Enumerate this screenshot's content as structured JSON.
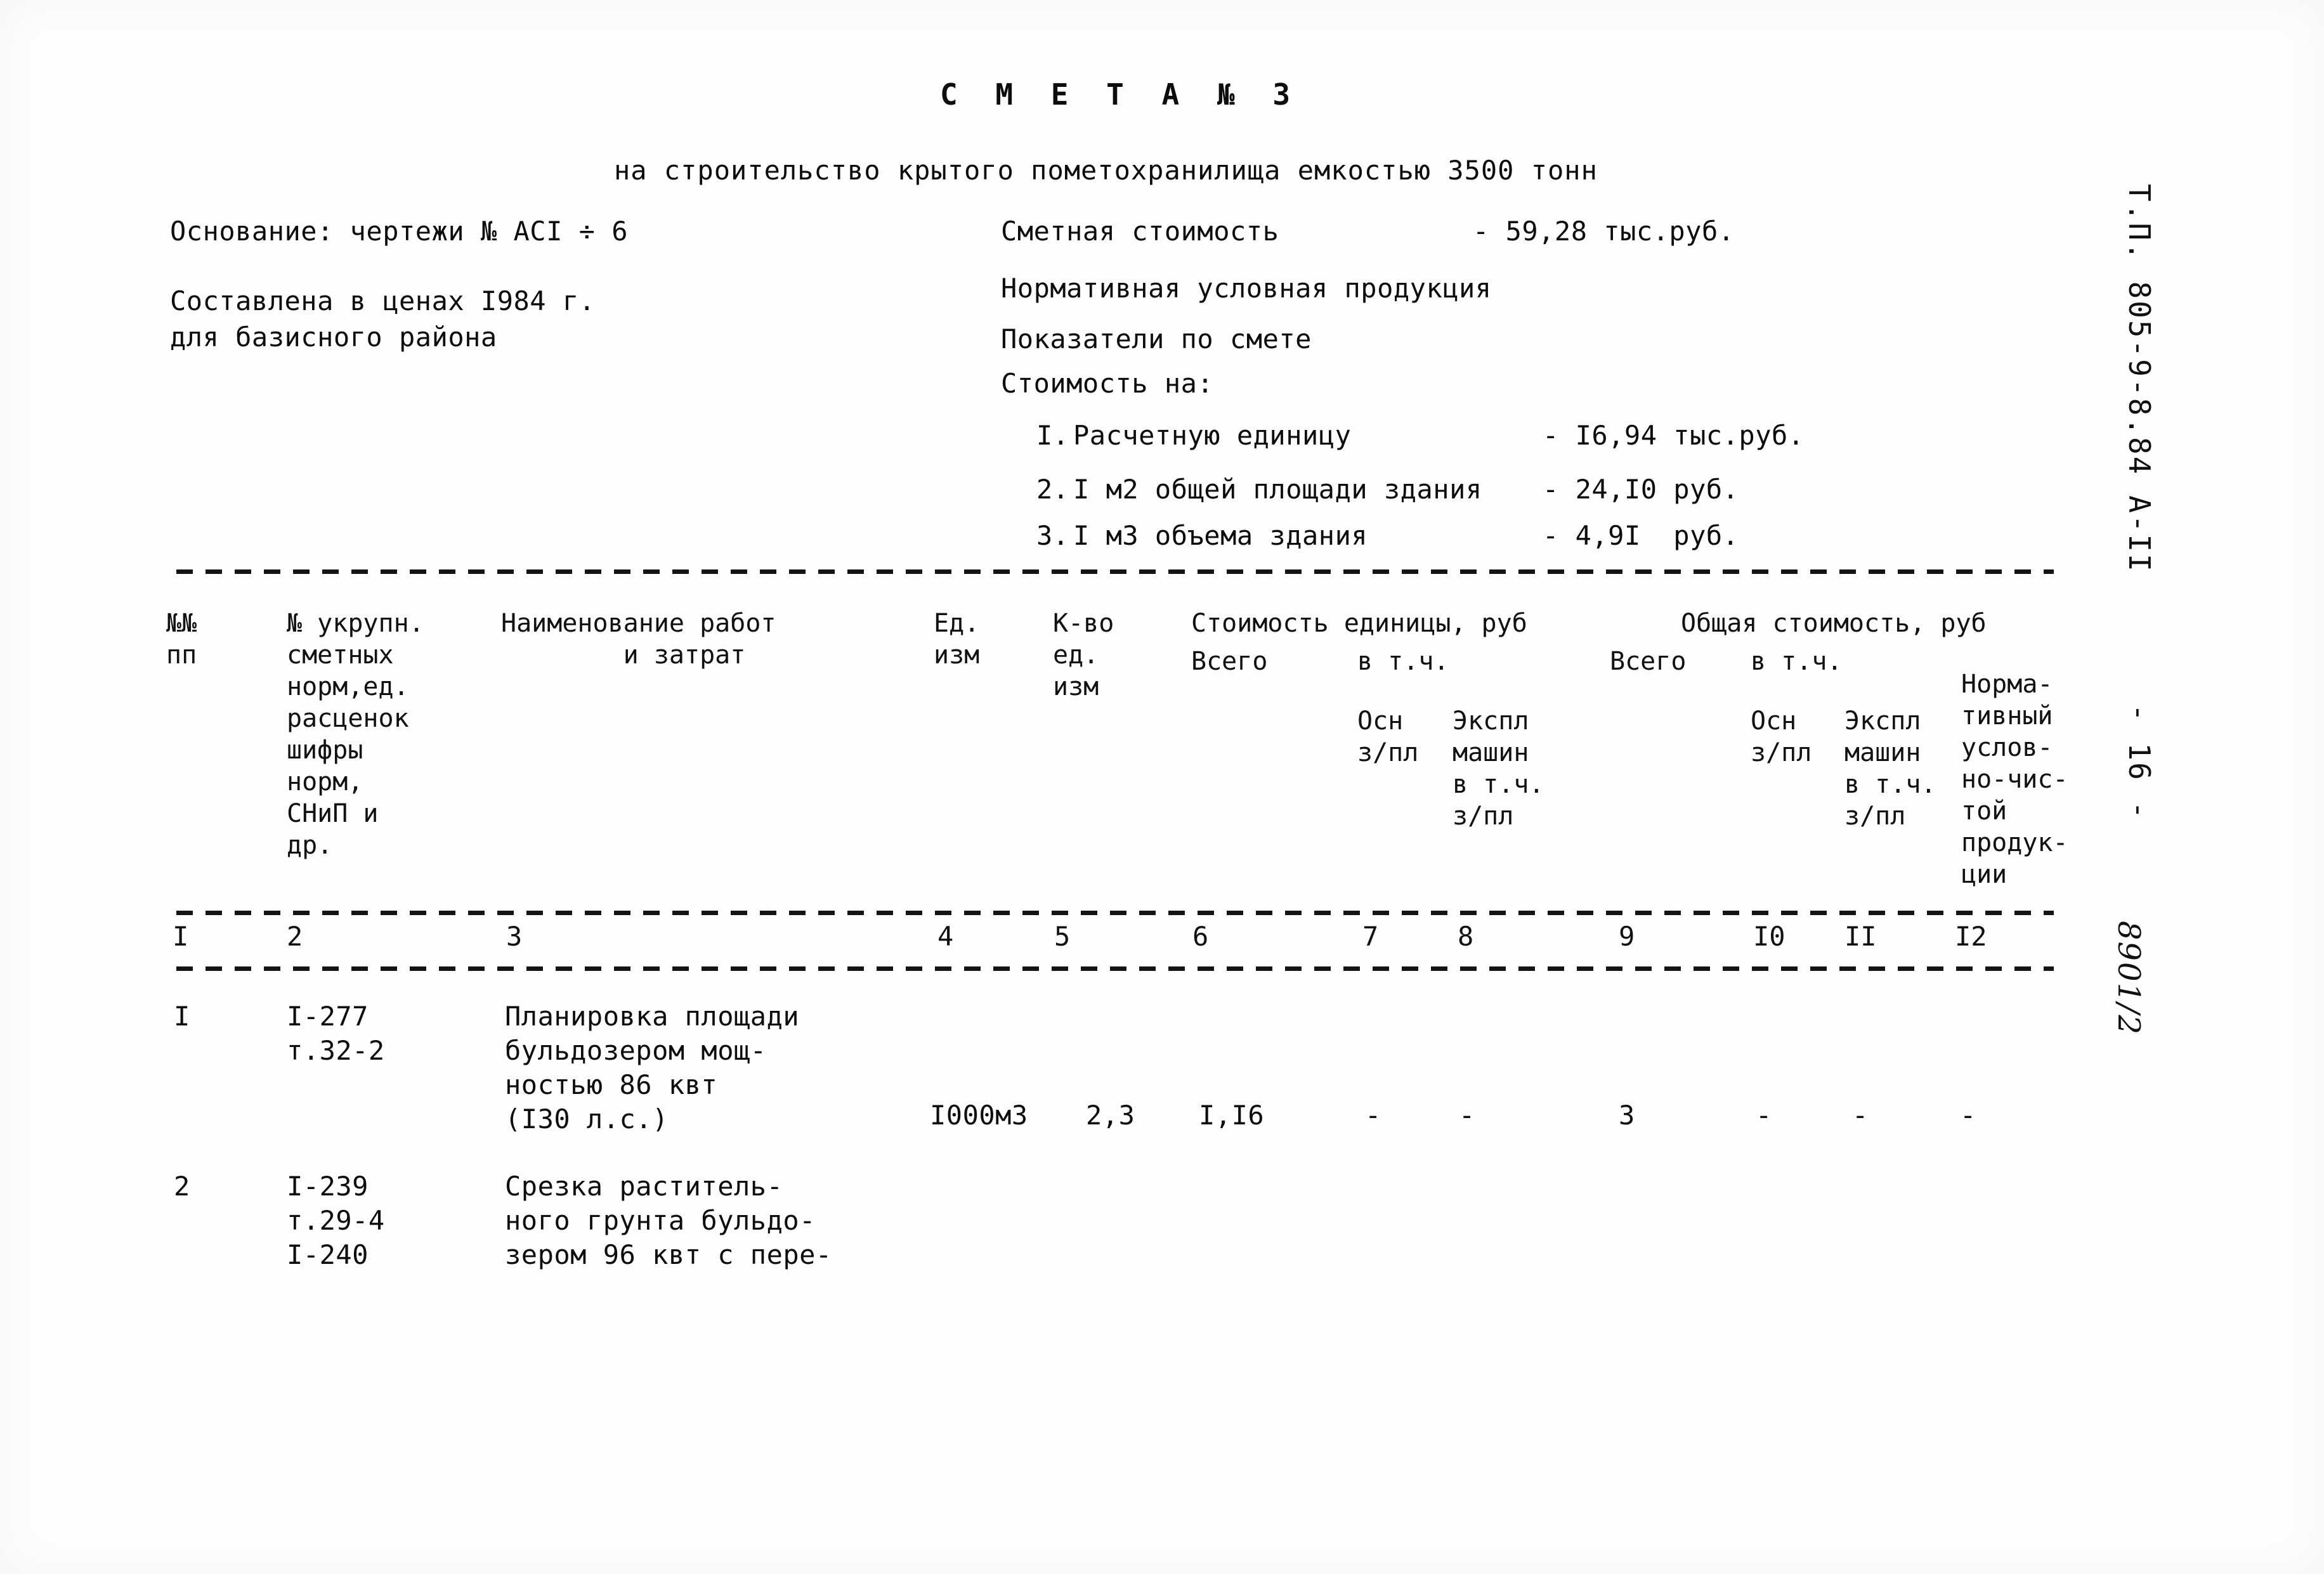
{
  "document": {
    "title": "С М Е Т А № 3",
    "subtitle": "на строительство крытого пометохранилища емкостью 3500 тонн"
  },
  "left_info": {
    "basis_line": "Основание: чертежи № АСI ÷ 6",
    "prices_line_1": "Составлена в ценах I984 г.",
    "prices_line_2": "для базисного района"
  },
  "right_info": {
    "estimate_cost_label": "Сметная стоимость",
    "estimate_cost_value": "- 59,28 тыс.руб.",
    "normative_product_label": "Нормативная условная продукция",
    "indicators_label": "Показатели по смете",
    "cost_for_label": "Стоимость на:",
    "items": [
      {
        "no": "I.",
        "label": "Расчетную единицу",
        "value": "- I6,94 тыс.руб."
      },
      {
        "no": "2.",
        "label": "I м2 общей площади здания",
        "value": "- 24,I0 руб."
      },
      {
        "no": "3.",
        "label": "I м3 объема здания",
        "value": "- 4,9I  руб."
      }
    ]
  },
  "table": {
    "headers": {
      "col1": "№№\nпп",
      "col2": "№ укрупн.\nсметных\nнорм,ед.\nрасценок\nшифры\nнорм,\nСНиП и\nдр.",
      "col3": "Наименование работ\n        и затрат",
      "col4": "Ед.\nизм",
      "col5": "К-во\nед.\nизм",
      "group_unit_cost": "Стоимость единицы, руб",
      "group_total_cost": "Общая стоимость, руб",
      "unit_total": "Всего",
      "unit_vtch": "в т.ч.",
      "unit_osn": "Осн\nз/пл",
      "unit_expl": "Экспл\nмашин\nв т.ч.\nз/пл",
      "total_total": "Всего",
      "total_vtch": "в т.ч.",
      "total_osn": "Осн\nз/пл",
      "total_expl": "Экспл\nмашин\nв т.ч.\nз/пл",
      "col12": "Норма-\nтивный\nуслов-\nно-чис-\nтой\nпродук-\nции"
    },
    "column_numbers": [
      "I",
      "2",
      "3",
      "4",
      "5",
      "6",
      "7",
      "8",
      "9",
      "I0",
      "II",
      "I2"
    ],
    "rows": [
      {
        "no": "I",
        "norm_code": "I-277\nт.32-2",
        "description": "Планировка площади\nбульдозером мощ-\nностью 86 квт\n(I30 л.с.)",
        "unit": "I000м3",
        "qty": "2,3",
        "unit_total": "I,I6",
        "unit_osn": "-",
        "unit_expl": "-",
        "total_total": "3",
        "total_osn": "-",
        "total_expl": "-",
        "nchp": "-"
      },
      {
        "no": "2",
        "norm_code": "I-239\nт.29-4\nI-240",
        "description": "Срезка раститель-\nного грунта бульдо-\nзером 96 квт с пере-",
        "unit": "",
        "qty": "",
        "unit_total": "",
        "unit_osn": "",
        "unit_expl": "",
        "total_total": "",
        "total_osn": "",
        "total_expl": "",
        "nchp": ""
      }
    ]
  },
  "margin": {
    "series_code": "Т.П. 805-9-8.84 А-II",
    "page_number": "- 16 -",
    "archive_number": "8901/2"
  }
}
